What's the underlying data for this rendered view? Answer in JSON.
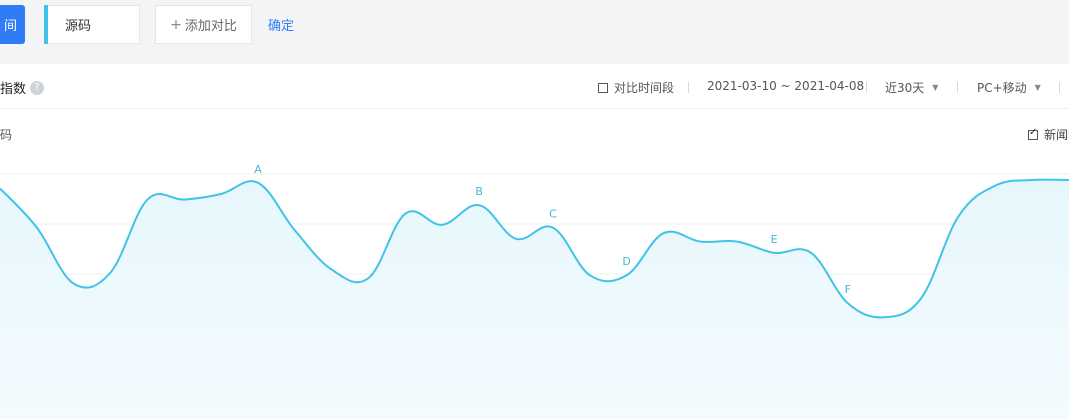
{
  "topbar": {
    "primary_label": "间",
    "keyword": "源码",
    "add_label": "添加对比",
    "confirm_label": "确定"
  },
  "card": {
    "title": "指数",
    "help": "?",
    "compare_label": "对比时间段",
    "date_range": "2021-03-10 ~ 2021-04-08",
    "period": "近30天",
    "device": "PC+移动",
    "series_label": "码",
    "legend_label": "新闻"
  },
  "colors": {
    "accent": "#2f7cf6",
    "series": "#41c3e8"
  },
  "chart_data": {
    "type": "area",
    "x": [
      "2021-03-10",
      "2021-03-11",
      "2021-03-12",
      "2021-03-13",
      "2021-03-14",
      "2021-03-15",
      "2021-03-16",
      "2021-03-17",
      "2021-03-18",
      "2021-03-19",
      "2021-03-20",
      "2021-03-21",
      "2021-03-22",
      "2021-03-23",
      "2021-03-24",
      "2021-03-25",
      "2021-03-26",
      "2021-03-27",
      "2021-03-28",
      "2021-03-29",
      "2021-03-30",
      "2021-03-31",
      "2021-04-01",
      "2021-04-02",
      "2021-04-03",
      "2021-04-04",
      "2021-04-05",
      "2021-04-06",
      "2021-04-07",
      "2021-04-08"
    ],
    "values": [
      77,
      63,
      43,
      47,
      73,
      73,
      75,
      79,
      62,
      48,
      45,
      68,
      64,
      71,
      59,
      63,
      46,
      46,
      61,
      58,
      58,
      54,
      54,
      36,
      31,
      38,
      67,
      78,
      80,
      80
    ],
    "annotations": [
      {
        "label": "A",
        "x": "2021-03-17"
      },
      {
        "label": "B",
        "x": "2021-03-23"
      },
      {
        "label": "C",
        "x": "2021-03-25"
      },
      {
        "label": "D",
        "x": "2021-03-27"
      },
      {
        "label": "E",
        "x": "2021-03-31"
      },
      {
        "label": "F",
        "x": "2021-04-02"
      }
    ],
    "ylim": [
      0,
      100
    ],
    "grid": true
  }
}
